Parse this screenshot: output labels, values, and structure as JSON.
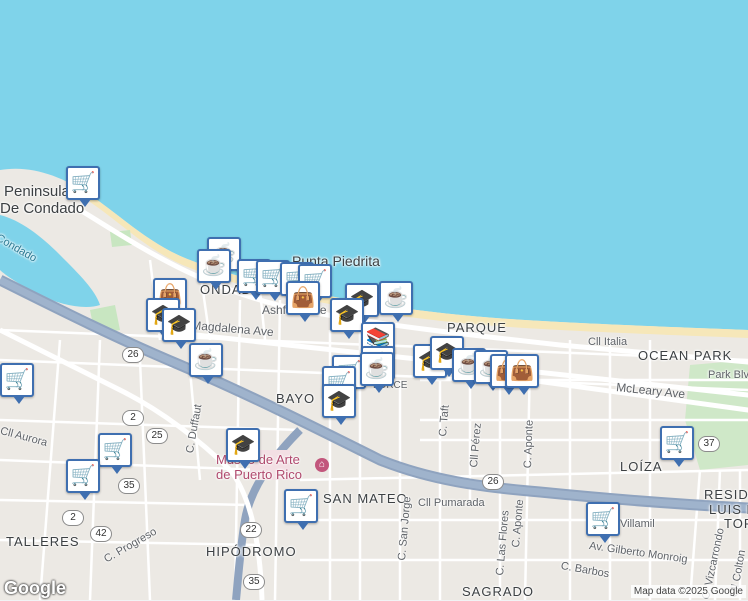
{
  "places": {
    "peninsula": "Peninsula",
    "de_condado": "De Condado",
    "condado": "Condado",
    "punta_piedrita": "Punta Piedrita",
    "ondado": "ONDADO",
    "ashford": "Ashford Ave",
    "magdalena": "Magdalena Ave",
    "parque": "PARQUE",
    "ocean_park": "OCEAN PARK",
    "bayola": "BAYO",
    "park_blvd": "Park Blvd",
    "mcleary": "McLeary Ave",
    "cll_italia": "Cll Italia",
    "cll_aurora": "Cll Aurora",
    "c_duffaut": "C. Duffaut",
    "museo_1": "Museo de Arte",
    "museo_2": "de Puerto Rico",
    "san_mateo": "SAN MATEO",
    "cll_pumarada": "Cll Pumarada",
    "c_san_jorge": "C. San Jorge",
    "c_taft": "C. Taft",
    "cll_perez": "Cll Pérez",
    "c_aponte": "C. Aponte",
    "c_aponte2": "C. Aponte",
    "c_las_flores": "C. Las Flores",
    "loiza": "LOÍZA",
    "residencial": "RESIDE",
    "luis_llorens": "LUIS LL",
    "tor": "TOR",
    "av_gilberto": "Av. Gilberto Monroig",
    "c_barbos": "C. Barbos",
    "villamil": "Villamil",
    "talleres": "TALLERES",
    "c_progreso": "C. Progreso",
    "hipodromo": "HIPÓDROMO",
    "sagrado": "SAGRADO",
    "c_vizcarrondo": "C. Vizcarrondo",
    "cll_colton": "Cll Colton",
    "lorce": "LORCE"
  },
  "shields": [
    "26",
    "2",
    "25",
    "35",
    "2",
    "42",
    "22",
    "26",
    "37",
    "35"
  ],
  "attribution": "Map data ©2025 Google",
  "logo": "Google",
  "pins": [
    {
      "icon": "cart-icon",
      "glyph": "🛒"
    },
    {
      "icon": "coffee-icon",
      "glyph": "☕"
    },
    {
      "icon": "coffee-icon",
      "glyph": "☕"
    },
    {
      "icon": "cart-icon",
      "glyph": "🛒"
    },
    {
      "icon": "cart-icon",
      "glyph": "🛒"
    },
    {
      "icon": "cart-icon",
      "glyph": "🛒"
    },
    {
      "icon": "cart-icon",
      "glyph": "🛒"
    },
    {
      "icon": "school-icon",
      "glyph": "🎓"
    },
    {
      "icon": "bag-icon",
      "glyph": "👜"
    },
    {
      "icon": "coffee-icon",
      "glyph": "☕"
    },
    {
      "icon": "bag-icon",
      "glyph": "👜"
    },
    {
      "icon": "school-icon",
      "glyph": "🎓"
    },
    {
      "icon": "school-icon",
      "glyph": "🎓"
    },
    {
      "icon": "school-icon",
      "glyph": "🎓"
    },
    {
      "icon": "coffee-icon",
      "glyph": "☕"
    },
    {
      "icon": "library-icon",
      "glyph": "📚"
    },
    {
      "icon": "coffee-icon",
      "glyph": "☕"
    },
    {
      "icon": "cart-icon",
      "glyph": "🛒"
    },
    {
      "icon": "cart-icon",
      "glyph": "🛒"
    },
    {
      "icon": "school-icon",
      "glyph": "🎓"
    },
    {
      "icon": "coffee-icon",
      "glyph": "☕"
    },
    {
      "icon": "school-icon",
      "glyph": "🎓"
    },
    {
      "icon": "school-icon",
      "glyph": "🎓"
    },
    {
      "icon": "coffee-icon",
      "glyph": "☕"
    },
    {
      "icon": "coffee-icon",
      "glyph": "☕"
    },
    {
      "icon": "bag-icon",
      "glyph": "👜"
    },
    {
      "icon": "bag-icon",
      "glyph": "👜"
    },
    {
      "icon": "cart-icon",
      "glyph": "🛒"
    },
    {
      "icon": "cart-icon",
      "glyph": "🛒"
    },
    {
      "icon": "cart-icon",
      "glyph": "🛒"
    },
    {
      "icon": "school-icon",
      "glyph": "🎓"
    },
    {
      "icon": "cart-icon",
      "glyph": "🛒"
    },
    {
      "icon": "cart-icon",
      "glyph": "🛒"
    },
    {
      "icon": "cart-icon",
      "glyph": "🛒"
    }
  ]
}
